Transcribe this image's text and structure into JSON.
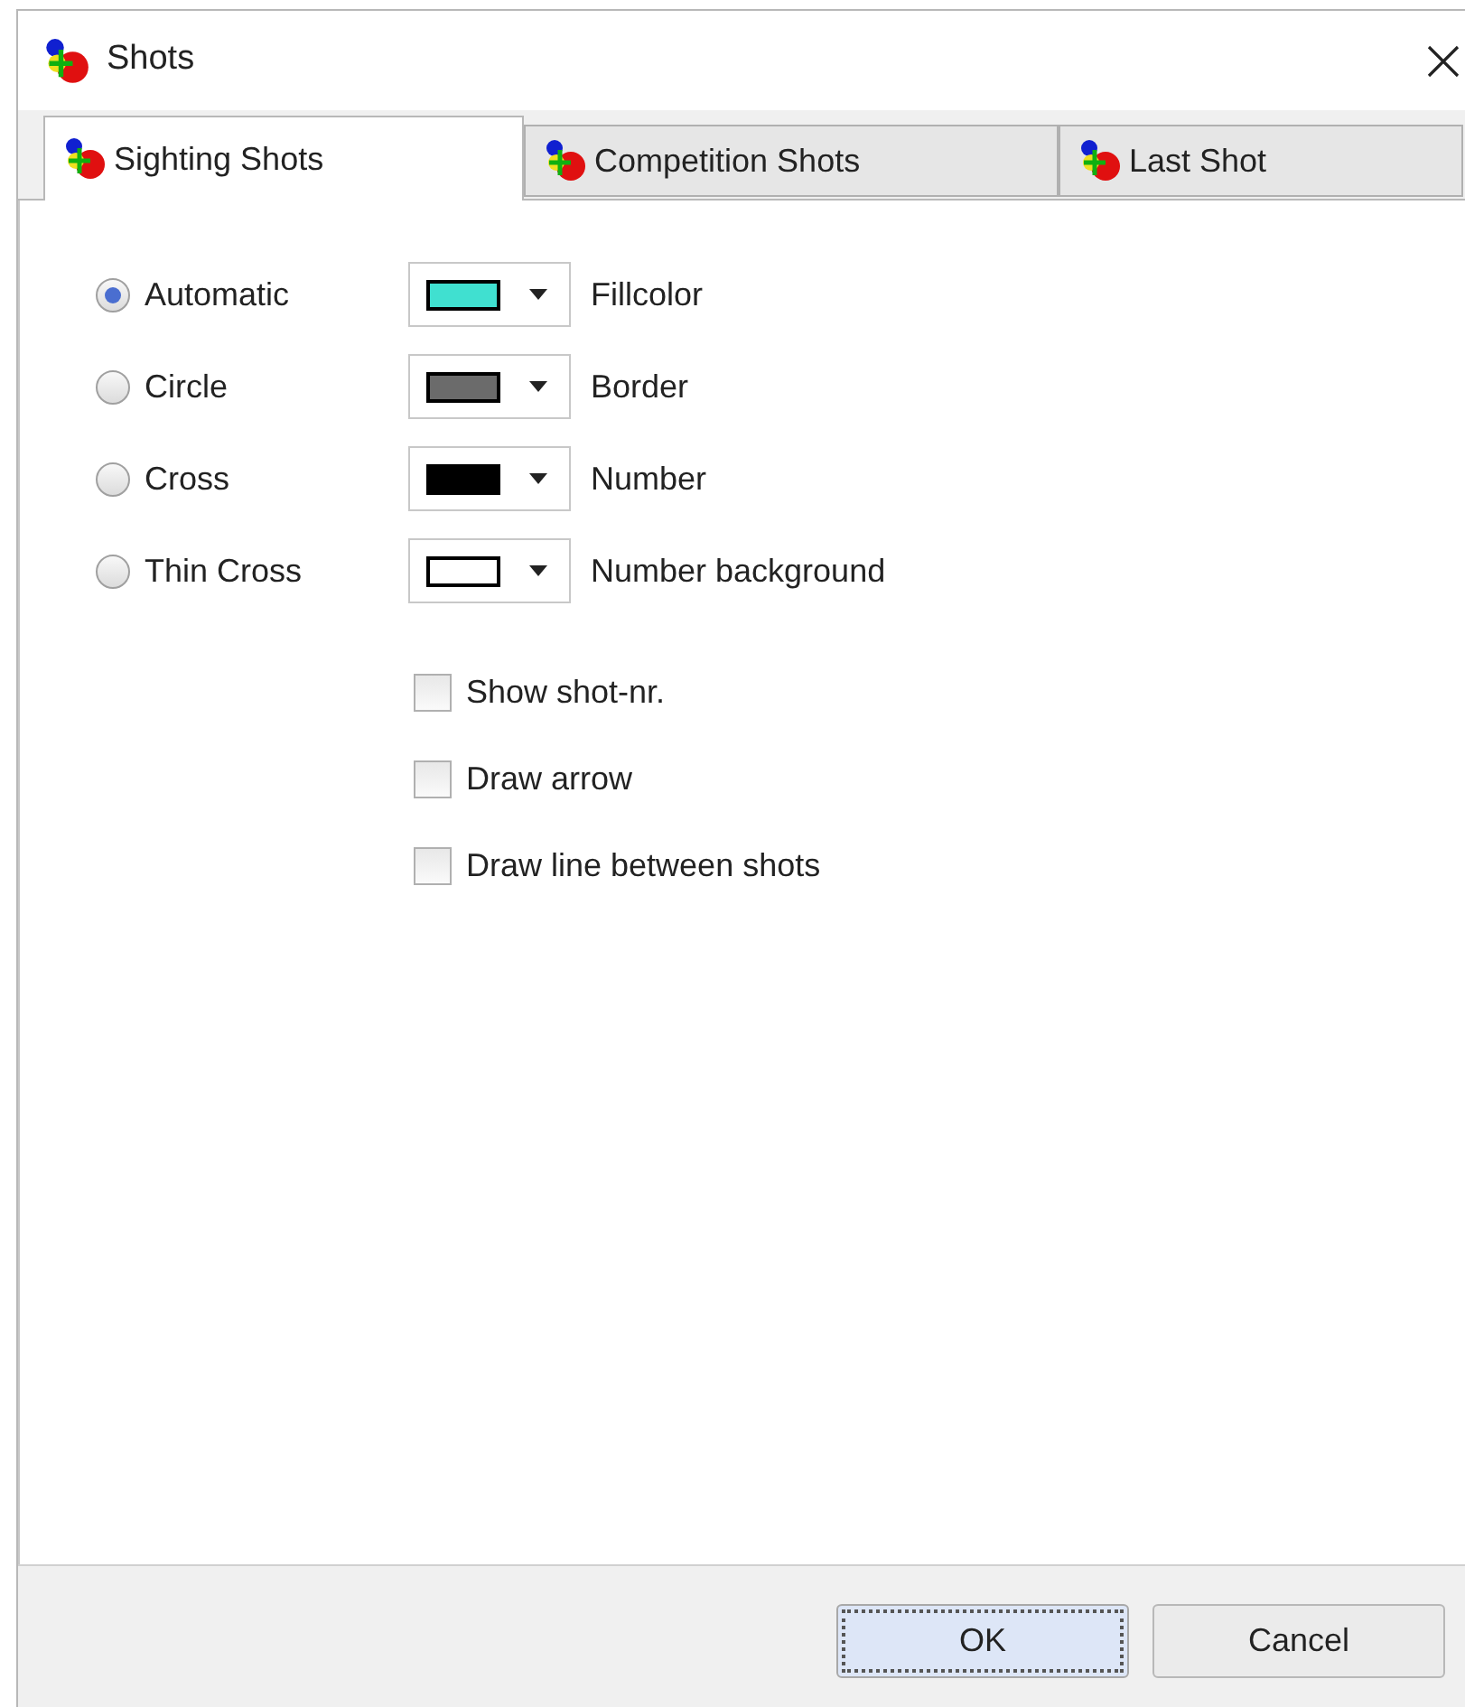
{
  "window": {
    "title": "Shots"
  },
  "tabs": [
    {
      "label": "Sighting Shots",
      "selected": true
    },
    {
      "label": "Competition Shots",
      "selected": false
    },
    {
      "label": "Last Shot",
      "selected": false
    }
  ],
  "shape_options": [
    {
      "label": "Automatic",
      "selected": true
    },
    {
      "label": "Circle",
      "selected": false
    },
    {
      "label": "Cross",
      "selected": false
    },
    {
      "label": "Thin Cross",
      "selected": false
    }
  ],
  "color_pickers": [
    {
      "label": "Fillcolor",
      "color": "#40e0d0"
    },
    {
      "label": "Border",
      "color": "#6b6b6b"
    },
    {
      "label": "Number",
      "color": "#000000"
    },
    {
      "label": "Number background",
      "color": "#ffffff"
    }
  ],
  "checkboxes": [
    {
      "label": "Show shot-nr.",
      "checked": false
    },
    {
      "label": "Draw arrow",
      "checked": false
    },
    {
      "label": "Draw line between shots",
      "checked": false
    }
  ],
  "buttons": [
    {
      "label": "OK",
      "focused": true
    },
    {
      "label": "Cancel",
      "focused": false
    }
  ]
}
